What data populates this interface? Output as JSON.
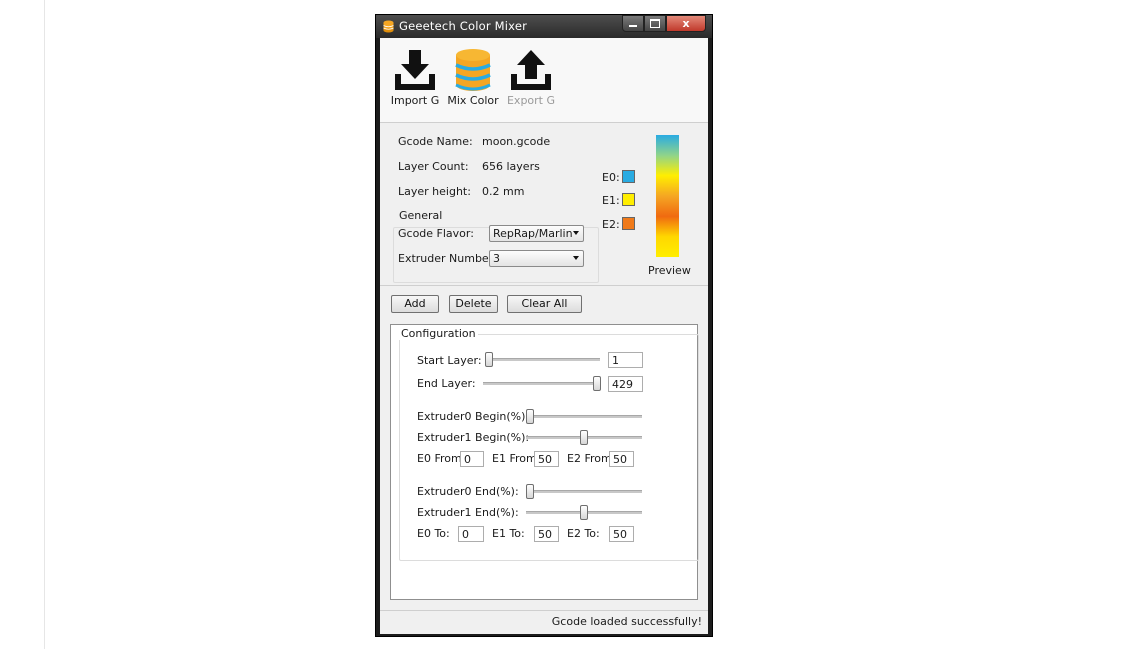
{
  "window": {
    "title": "Geeetech Color Mixer",
    "close_glyph": "x"
  },
  "toolbar": {
    "import_label": "Import G",
    "mix_label": "Mix Color",
    "export_label": "Export G",
    "import_icon": "download-tray-icon",
    "mix_icon": "database-stack-icon",
    "export_icon": "upload-tray-icon",
    "export_enabled": false
  },
  "info": {
    "gcode_name_label": "Gcode Name:",
    "gcode_name_value": "moon.gcode",
    "layer_count_label": "Layer Count:",
    "layer_count_value": "656 layers",
    "layer_height_label": "Layer height:",
    "layer_height_value": "0.2 mm"
  },
  "general": {
    "title": "General",
    "flavor_label": "Gcode Flavor:",
    "flavor_value": "RepRap/Marlin",
    "extruder_label": "Extruder Number",
    "extruder_value": "3"
  },
  "extruders": [
    {
      "label": "E0:",
      "color": "#29abe2"
    },
    {
      "label": "E1:",
      "color": "#ffee00"
    },
    {
      "label": "E2:",
      "color": "#f07a1a"
    }
  ],
  "preview": {
    "label": "Preview",
    "gradient_colors": [
      "#29abe2",
      "#8fd48a",
      "#ffee00",
      "#f5a623",
      "#f06a10",
      "#ffd700",
      "#ffee00"
    ]
  },
  "actions": {
    "add": "Add",
    "delete": "Delete",
    "clear_all": "Clear All"
  },
  "config": {
    "title": "Configuration",
    "start_layer_label": "Start Layer:",
    "start_layer_value": "1",
    "start_layer_fraction": 0.0,
    "end_layer_label": "End Layer:",
    "end_layer_value": "429",
    "end_layer_fraction": 1.0,
    "e0_begin_label": "Extruder0 Begin(%):",
    "e0_begin_fraction": 0.0,
    "e1_begin_label": "Extruder1 Begin(%):",
    "e1_begin_fraction": 0.5,
    "e0_from_label": "E0 From:",
    "e0_from_value": "0",
    "e1_from_label": "E1 From:",
    "e1_from_value": "50",
    "e2_from_label": "E2 From:",
    "e2_from_value": "50",
    "e0_end_label": "Extruder0 End(%):",
    "e0_end_fraction": 0.0,
    "e1_end_label": "Extruder1 End(%):",
    "e1_end_fraction": 0.5,
    "e0_to_label": "E0 To:",
    "e0_to_value": "0",
    "e1_to_label": "E1 To:",
    "e1_to_value": "50",
    "e2_to_label": "E2 To:",
    "e2_to_value": "50"
  },
  "status": {
    "message": "Gcode loaded successfully!"
  }
}
